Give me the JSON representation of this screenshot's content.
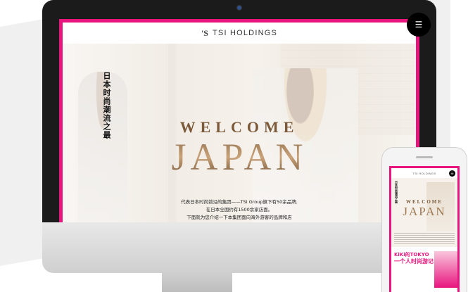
{
  "desktop": {
    "header": {
      "logo_mark": "'S",
      "logo_text": "TSI HOLDINGS"
    },
    "menu_icon": "hamburger-icon",
    "hero": {
      "vertical_title": "日本时尚潮流之最",
      "welcome": "WELCOME",
      "japan": "JAPAN",
      "desc_line1": "代表日本时尚前沿的集团——TSI Group旗下有50余品牌,",
      "desc_line2": "在日本全国约有1500余家店面。",
      "desc_line3": "下面就为您介绍一下本集团面向海外游客的品牌和店"
    }
  },
  "mobile": {
    "header": {
      "logo_text": "TSI HOLDINGS"
    },
    "menu_icon": "hamburger-icon",
    "hero": {
      "vertical_title": "日本时尚潮流之最",
      "welcome": "WELCOME",
      "japan": "JAPAN"
    },
    "feature": {
      "line1": "KiKi的TOKYO",
      "line2": "一个人时尚游记!"
    }
  },
  "colors": {
    "accent": "#e8157f",
    "bezel": "#1b1b1b",
    "menu_bg": "#000000"
  }
}
